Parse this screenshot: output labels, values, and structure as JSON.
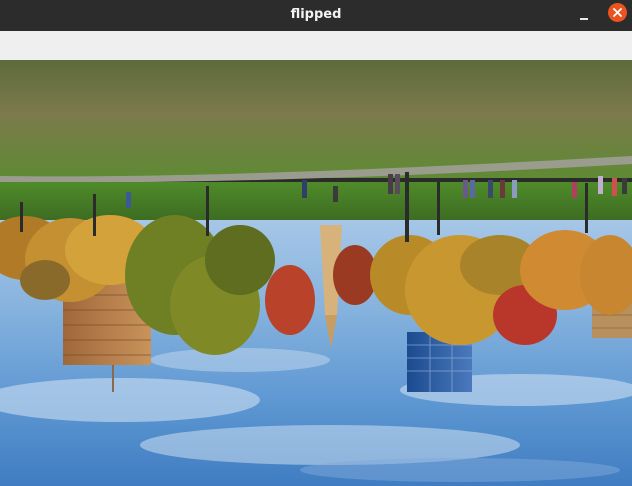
{
  "window": {
    "title": "flipped",
    "minimize_icon": "minimize-icon",
    "close_icon": "close-icon",
    "accent": "#e95420"
  },
  "image": {
    "description_icon": "image-canvas"
  }
}
